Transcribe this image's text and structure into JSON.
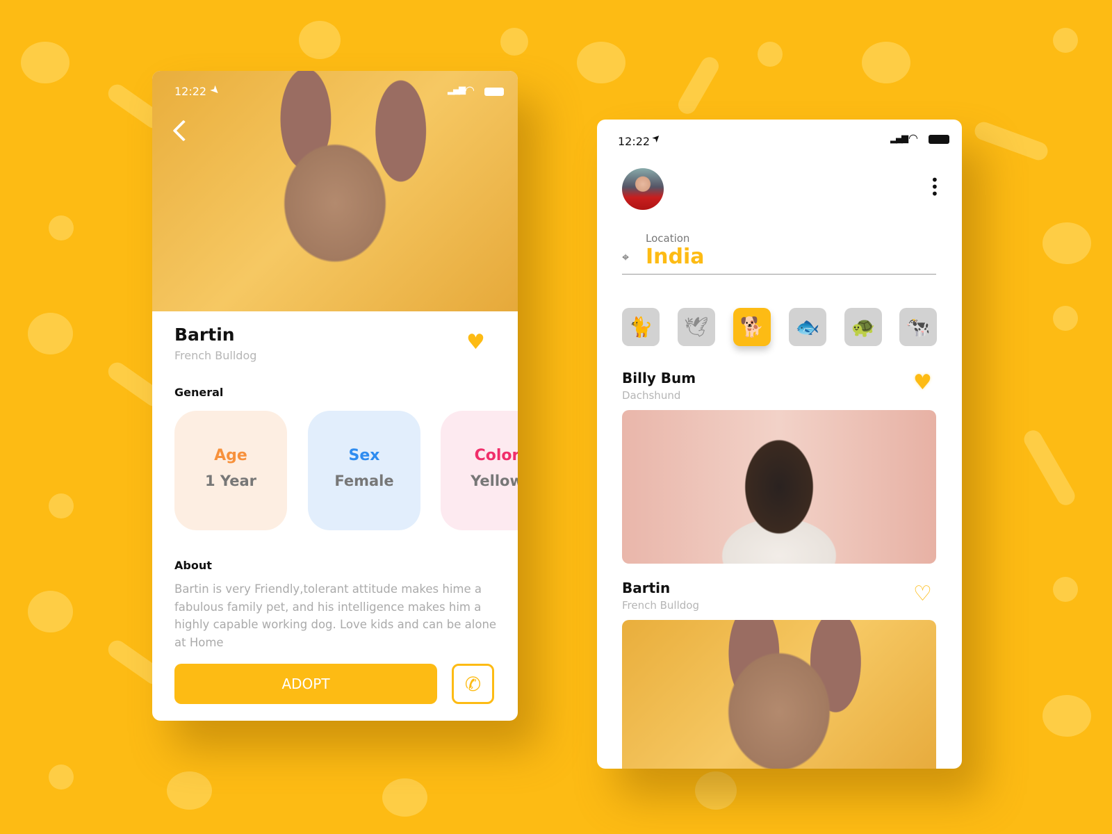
{
  "detail": {
    "status": {
      "time": "12:22"
    },
    "name": "Bartin",
    "breed": "French Bulldog",
    "favorited": true,
    "general_label": "General",
    "cards": [
      {
        "label": "Age",
        "value": "1 Year",
        "label_color": "#f7913c",
        "bg": "#fdeee2"
      },
      {
        "label": "Sex",
        "value": "Female",
        "label_color": "#2e8cf0",
        "bg": "#e2eefc"
      },
      {
        "label": "Color",
        "value": "Yellow",
        "label_color": "#f02e6a",
        "bg": "#fdeaf0"
      }
    ],
    "about_label": "About",
    "about_text": "Bartin is very Friendly,tolerant attitude makes hime a fabulous family pet, and his intelligence makes him a highly capable working dog. Love kids and can be alone at Home",
    "adopt_label": "ADOPT"
  },
  "list": {
    "status": {
      "time": "12:22"
    },
    "location_label": "Location",
    "location_value": "India",
    "categories": [
      {
        "icon": "cat-icon",
        "glyph": "🐈",
        "active": false
      },
      {
        "icon": "bird-icon",
        "glyph": "🕊",
        "active": false
      },
      {
        "icon": "dog-icon",
        "glyph": "🐕",
        "active": true
      },
      {
        "icon": "fish-icon",
        "glyph": "🐟",
        "active": false
      },
      {
        "icon": "turtle-icon",
        "glyph": "🐢",
        "active": false
      },
      {
        "icon": "cow-icon",
        "glyph": "🐄",
        "active": false
      }
    ],
    "pets": [
      {
        "name": "Billy Bum",
        "breed": "Dachshund",
        "favorited": true
      },
      {
        "name": "Bartin",
        "breed": "French Bulldog",
        "favorited": false
      }
    ]
  },
  "colors": {
    "accent": "#fdbb14",
    "background": "#fdbb14"
  }
}
